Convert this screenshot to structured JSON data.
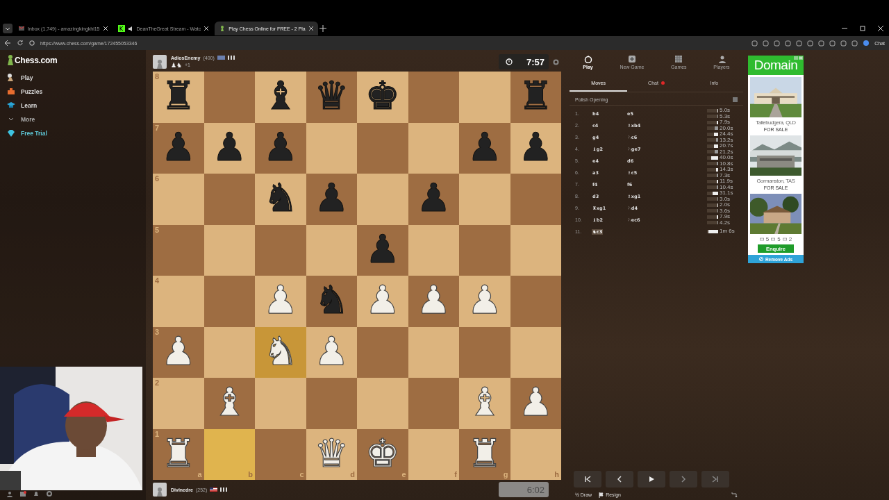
{
  "browser": {
    "tabs": [
      {
        "title": "Inbox (1,749) - amazingkingkhi15",
        "kind": "mail",
        "selected": false
      },
      {
        "title": "DeanTheGreat Stream - Watc",
        "kind": "stream",
        "selected": false
      },
      {
        "title": "Play Chess Online for FREE - 2 Pla",
        "kind": "pawn",
        "selected": true
      }
    ],
    "url": "https://www.chess.com/game/172455053346",
    "chat_label": "Chat"
  },
  "sidebar": {
    "logo": "Chess.com",
    "items": [
      {
        "label": "Play",
        "kind": "play"
      },
      {
        "label": "Puzzles",
        "kind": "puzzles"
      },
      {
        "label": "Learn",
        "kind": "learn"
      },
      {
        "label": "More",
        "kind": "more"
      },
      {
        "label": "Free Trial",
        "kind": "trial"
      }
    ]
  },
  "top_player": {
    "name": "AdiosEnemy",
    "rating": "(400)",
    "captured": "♟♞",
    "advantage": "+1",
    "clock": "7:57",
    "clock_active": true
  },
  "bottom_player": {
    "name": "Divinedre",
    "rating": "(252)",
    "clock": "6:02",
    "clock_active": false
  },
  "board": {
    "file_labels": [
      "a",
      "b",
      "c",
      "d",
      "e",
      "f",
      "g",
      "h"
    ],
    "ranks": [
      {
        "label": "8",
        "squares": [
          {
            "highlighted": false,
            "piece": "♜",
            "kind": "black"
          },
          {
            "highlighted": false
          },
          {
            "highlighted": false,
            "piece": "♝",
            "kind": "black"
          },
          {
            "highlighted": false,
            "piece": "♛",
            "kind": "black"
          },
          {
            "highlighted": false,
            "piece": "♚",
            "kind": "black"
          },
          {
            "highlighted": false
          },
          {
            "highlighted": false
          },
          {
            "highlighted": false,
            "piece": "♜",
            "kind": "black"
          }
        ]
      },
      {
        "label": "7",
        "squares": [
          {
            "highlighted": false,
            "piece": "♟",
            "kind": "black"
          },
          {
            "highlighted": false,
            "piece": "♟",
            "kind": "black"
          },
          {
            "highlighted": false,
            "piece": "♟",
            "kind": "black"
          },
          {
            "highlighted": false
          },
          {
            "highlighted": false
          },
          {
            "highlighted": false
          },
          {
            "highlighted": false,
            "piece": "♟",
            "kind": "black"
          },
          {
            "highlighted": false,
            "piece": "♟",
            "kind": "black"
          }
        ]
      },
      {
        "label": "6",
        "squares": [
          {
            "highlighted": false
          },
          {
            "highlighted": false
          },
          {
            "highlighted": false,
            "piece": "♞",
            "kind": "black"
          },
          {
            "highlighted": false,
            "piece": "♟",
            "kind": "black"
          },
          {
            "highlighted": false
          },
          {
            "highlighted": false,
            "piece": "♟",
            "kind": "black"
          },
          {
            "highlighted": false
          },
          {
            "highlighted": false
          }
        ]
      },
      {
        "label": "5",
        "squares": [
          {
            "highlighted": false
          },
          {
            "highlighted": false
          },
          {
            "highlighted": false
          },
          {
            "highlighted": false
          },
          {
            "highlighted": false,
            "piece": "♟",
            "kind": "black"
          },
          {
            "highlighted": false
          },
          {
            "highlighted": false
          },
          {
            "highlighted": false
          }
        ]
      },
      {
        "label": "4",
        "squares": [
          {
            "highlighted": false
          },
          {
            "highlighted": false
          },
          {
            "highlighted": false,
            "piece": "♟",
            "kind": "white"
          },
          {
            "highlighted": false,
            "piece": "♞",
            "kind": "black"
          },
          {
            "highlighted": false,
            "piece": "♟",
            "kind": "white"
          },
          {
            "highlighted": false,
            "piece": "♟",
            "kind": "white"
          },
          {
            "highlighted": false,
            "piece": "♟",
            "kind": "white"
          },
          {
            "highlighted": false
          }
        ]
      },
      {
        "label": "3",
        "squares": [
          {
            "highlighted": false,
            "piece": "♟",
            "kind": "white"
          },
          {
            "highlighted": false
          },
          {
            "highlighted": true,
            "piece": "♞",
            "kind": "white"
          },
          {
            "highlighted": false,
            "piece": "♟",
            "kind": "white"
          },
          {
            "highlighted": false
          },
          {
            "highlighted": false
          },
          {
            "highlighted": false
          },
          {
            "highlighted": false
          }
        ]
      },
      {
        "label": "2",
        "squares": [
          {
            "highlighted": false
          },
          {
            "highlighted": false,
            "piece": "♝",
            "kind": "white"
          },
          {
            "highlighted": false
          },
          {
            "highlighted": false
          },
          {
            "highlighted": false
          },
          {
            "highlighted": false
          },
          {
            "highlighted": false,
            "piece": "♝",
            "kind": "white"
          },
          {
            "highlighted": false,
            "piece": "♟",
            "kind": "white"
          }
        ]
      },
      {
        "label": "1",
        "squares": [
          {
            "highlighted": false,
            "piece": "♜",
            "kind": "white"
          },
          {
            "highlighted": true
          },
          {
            "highlighted": false
          },
          {
            "highlighted": false,
            "piece": "♛",
            "kind": "white"
          },
          {
            "highlighted": false,
            "piece": "♚",
            "kind": "white"
          },
          {
            "highlighted": false
          },
          {
            "highlighted": false,
            "piece": "♜",
            "kind": "white"
          },
          {
            "highlighted": false
          }
        ]
      }
    ]
  },
  "panel": {
    "nav": [
      {
        "label": "Play",
        "kind": "play",
        "selected": true
      },
      {
        "label": "New Game",
        "kind": "new",
        "selected": false
      },
      {
        "label": "Games",
        "kind": "games",
        "selected": false
      },
      {
        "label": "Players",
        "kind": "players",
        "selected": false
      }
    ],
    "tabs": [
      {
        "label": "Moves",
        "selected": true,
        "unread": false
      },
      {
        "label": "Chat",
        "selected": false,
        "unread": true
      },
      {
        "label": "Info",
        "selected": false,
        "unread": false
      }
    ],
    "opening": "Polish Opening",
    "moves": [
      {
        "number": "1.",
        "white": {
          "san": "b4",
          "selected": false,
          "time": "5.0s",
          "level": 0.06
        },
        "black": {
          "san": "e5",
          "selected": false,
          "time": "5.3s",
          "level": 0.06
        }
      },
      {
        "number": "2.",
        "white": {
          "san": "c4",
          "selected": false,
          "time": "7.9s",
          "level": 0.1
        },
        "black": {
          "san": "♗xb4",
          "selected": false,
          "time": "20.0s",
          "level": 0.3
        }
      },
      {
        "number": "3.",
        "white": {
          "san": "g4",
          "selected": false,
          "time": "24.4s",
          "level": 0.4
        },
        "black": {
          "san": "♘c6",
          "selected": false,
          "time": "13.2s",
          "level": 0.2
        }
      },
      {
        "number": "4.",
        "white": {
          "san": "♝g2",
          "selected": false,
          "time": "20.7s",
          "level": 0.4
        },
        "black": {
          "san": "♘ge7",
          "selected": false,
          "time": "21.2s",
          "level": 0.3
        }
      },
      {
        "number": "5.",
        "white": {
          "san": "e4",
          "selected": false,
          "time": "40.0s",
          "level": 0.65
        },
        "black": {
          "san": "d6",
          "selected": false,
          "time": "10.8s",
          "level": 0.15
        }
      },
      {
        "number": "6.",
        "white": {
          "san": "a3",
          "selected": false,
          "time": "14.3s",
          "level": 0.2
        },
        "black": {
          "san": "♗c5",
          "selected": false,
          "time": "7.3s",
          "level": 0.1
        }
      },
      {
        "number": "7.",
        "white": {
          "san": "f4",
          "selected": false,
          "time": "11.9s",
          "level": 0.15
        },
        "black": {
          "san": "f6",
          "selected": false,
          "time": "10.4s",
          "level": 0.15
        }
      },
      {
        "number": "8.",
        "white": {
          "san": "d3",
          "selected": false,
          "time": "31.1s",
          "level": 0.5
        },
        "black": {
          "san": "♗xg1",
          "selected": false,
          "time": "3.0s",
          "level": 0.05
        }
      },
      {
        "number": "9.",
        "white": {
          "san": "♜xg1",
          "selected": false,
          "time": "2.0s",
          "level": 0.05
        },
        "black": {
          "san": "♘d4",
          "selected": false,
          "time": "3.6s",
          "level": 0.05
        }
      },
      {
        "number": "10.",
        "white": {
          "san": "♝b2",
          "selected": false,
          "time": "7.9s",
          "level": 0.1
        },
        "black": {
          "san": "♘ec6",
          "selected": false,
          "time": "4.2s",
          "level": 0.06
        }
      },
      {
        "number": "11.",
        "white": {
          "san": "♞c3",
          "selected": true,
          "time": "1m 6s",
          "level": 0.9
        }
      }
    ],
    "actions": [
      {
        "label": "½ Draw",
        "kind": "draw"
      },
      {
        "label": "Resign",
        "kind": "resign"
      }
    ]
  },
  "ad": {
    "brand": "Domain",
    "listings": [
      {
        "place": "Tallebudgera, QLD",
        "tag": "FOR SALE",
        "kind": "mansion"
      },
      {
        "place": "Gormanston, TAS",
        "tag": "FOR SALE",
        "kind": "misty"
      }
    ],
    "feature": {
      "kind": "garden",
      "beds": "5",
      "baths": "5",
      "cars": "2",
      "button": "Enquire"
    },
    "remove": "Remove Ads"
  }
}
